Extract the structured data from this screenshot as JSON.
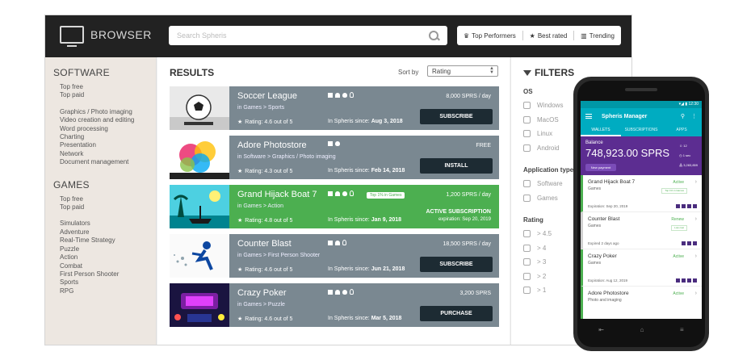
{
  "logo": {
    "text": "BROWSER",
    "icon": "monitor-icon"
  },
  "search": {
    "placeholder": "Search Spheris"
  },
  "quicklinks": [
    {
      "label": "Top Performers",
      "icon": "trophy-icon"
    },
    {
      "label": "Best rated",
      "icon": "star-icon"
    },
    {
      "label": "Trending",
      "icon": "bar-chart-icon"
    }
  ],
  "sidebar": {
    "software_title": "SOFTWARE",
    "software_top": [
      "Top free",
      "Top paid"
    ],
    "software_cats": [
      "Graphics / Photo imaging",
      "Video creation and editing",
      "Word processing",
      "Charting",
      "Presentation",
      "Network",
      "Document management"
    ],
    "games_title": "GAMES",
    "games_top": [
      "Top free",
      "Top paid"
    ],
    "games_cats": [
      "Simulators",
      "Adventure",
      "Real-Time Strategy",
      "Puzzle",
      "Action",
      "Combat",
      "First Person Shooter",
      "Sports",
      "RPG"
    ]
  },
  "results": {
    "title": "RESULTS",
    "sort_label": "Sort by",
    "sort_value": "Rating",
    "items": [
      {
        "name": "Soccer League",
        "category": "in Games > Sports",
        "rating": "Rating: 4.6 out of 5",
        "since_label": "In Spheris since:",
        "since": "Aug 3, 2018",
        "price": "8,000 SPRS / day",
        "button": "SUBSCRIBE"
      },
      {
        "name": "Adore Photostore",
        "category": "in Software > Graphics / Photo imaging",
        "rating": "Rating: 4.3 out of 5",
        "since_label": "In Spheris since:",
        "since": "Feb 14, 2018",
        "price": "FREE",
        "button": "INSTALL"
      },
      {
        "name": "Grand Hijack Boat 7",
        "category": "in Games > Action",
        "rating": "Rating: 4.8 out of 5",
        "since_label": "In Spheris since:",
        "since": "Jan 9, 2018",
        "price": "1,200 SPRS / day",
        "badge": "Top 1% in Games",
        "status": "ACTIVE SUBSCRIPTION",
        "expiration": "expiration: Sep 20, 2019"
      },
      {
        "name": "Counter Blast",
        "category": "in Games > First Person Shooter",
        "rating": "Rating: 4.6 out of 5",
        "since_label": "In Spheris since:",
        "since": "Jun 21, 2018",
        "price": "18,500 SPRS / day",
        "button": "SUBSCRIBE"
      },
      {
        "name": "Crazy Poker",
        "category": "in Games > Puzzle",
        "rating": "Rating: 4.6 out of 5",
        "since_label": "In Spheris since:",
        "since": "Mar 5, 2018",
        "price": "3,200 SPRS",
        "button": "PURCHASE"
      }
    ]
  },
  "filters": {
    "title": "FILTERS",
    "os_title": "OS",
    "os": [
      "Windows",
      "MacOS",
      "Linux",
      "Android"
    ],
    "type_title": "Application type",
    "type": [
      "Software",
      "Games"
    ],
    "rating_title": "Rating",
    "rating": [
      "> 4.5",
      "> 4",
      "> 3",
      "> 2",
      "> 1"
    ]
  },
  "phone": {
    "status_time": "12:30",
    "app_title": "Spheris Manager",
    "tabs": [
      "WALLETS",
      "SUBSCRIPTIONS",
      "APPS"
    ],
    "balance_label": "Balance",
    "balance_value": "748,923.00 SPRS",
    "new_payment": "New payment",
    "stats": [
      "12",
      "1 sec",
      "3,283,859"
    ],
    "subs": [
      {
        "name": "Grand Hijack Boat 7",
        "cat": "Games",
        "state": "Active",
        "pill": "Top 1% in Games",
        "exp": "Expiration: Sep 20, 2019",
        "active": true
      },
      {
        "name": "Counter Blast",
        "cat": "Games",
        "state": "Renew",
        "pill": "Low cost",
        "exp": "Expired 2 days ago",
        "active": false
      },
      {
        "name": "Crazy Poker",
        "cat": "Games",
        "state": "Active",
        "pill": "",
        "exp": "Expiration: Aug 12, 2019",
        "active": true
      },
      {
        "name": "Adore Photostore",
        "cat": "Photo and imaging",
        "state": "Active",
        "pill": "",
        "exp": "",
        "active": true
      }
    ]
  },
  "colors": {
    "accent_teal": "#00acc1",
    "balance_purple": "#5c2d91",
    "active_green": "#4caf50",
    "card_gray": "#7a8891",
    "topbar": "#222222"
  }
}
